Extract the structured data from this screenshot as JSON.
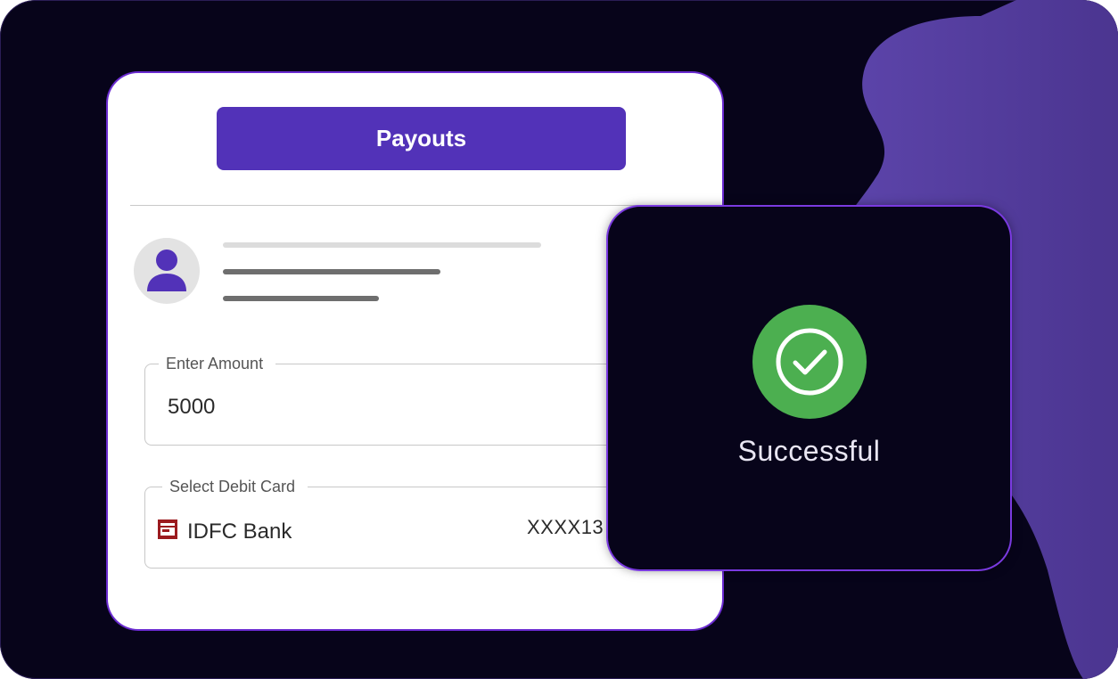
{
  "colors": {
    "background": "#07041a",
    "accent": "#5232b8",
    "blob": "#5a40a6",
    "success": "#4caf50",
    "card_border": "#6a2bd0"
  },
  "payouts_card": {
    "title_button": "Payouts",
    "avatar_icon": "user-icon",
    "amount_field": {
      "label": "Enter Amount",
      "value": "5000"
    },
    "debit_card_field": {
      "label": "Select Debit Card",
      "bank_icon": "bank-logo-icon",
      "bank_name": "IDFC Bank",
      "card_number": "XXXX13"
    }
  },
  "success_card": {
    "icon": "check-circle-icon",
    "status_text": "Successful"
  }
}
